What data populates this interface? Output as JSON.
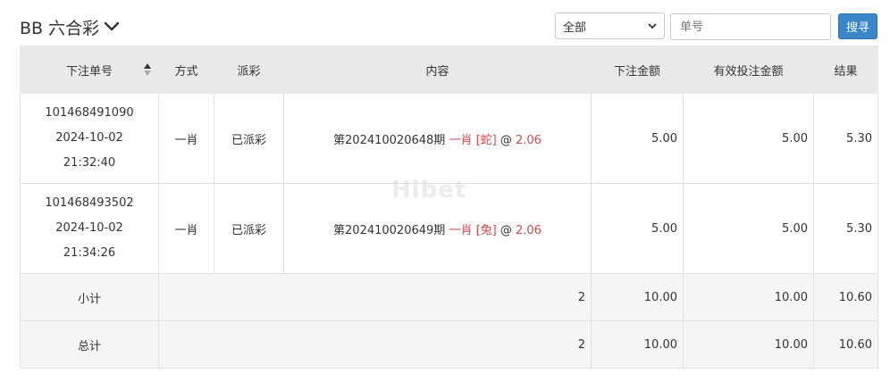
{
  "header": {
    "title": "BB 六合彩"
  },
  "filters": {
    "type_selected": "全部",
    "order_placeholder": "单号",
    "search_label": "搜寻"
  },
  "table": {
    "columns": [
      "下注单号",
      "方式",
      "派彩",
      "内容",
      "下注金额",
      "有效投注金额",
      "结果"
    ],
    "rows": [
      {
        "order_no": "101468491090",
        "date": "2024-10-02",
        "time": "21:32:40",
        "method": "一肖",
        "payout": "已派彩",
        "content_prefix": "第202410020648期",
        "content_bet": "一肖 [蛇]",
        "content_at": "@",
        "content_odds": "2.06",
        "bet_amount": "5.00",
        "valid_amount": "5.00",
        "result": "5.30"
      },
      {
        "order_no": "101468493502",
        "date": "2024-10-02",
        "time": "21:34:26",
        "method": "一肖",
        "payout": "已派彩",
        "content_prefix": "第202410020649期",
        "content_bet": "一肖 [兔]",
        "content_at": "@",
        "content_odds": "2.06",
        "bet_amount": "5.00",
        "valid_amount": "5.00",
        "result": "5.30"
      }
    ],
    "subtotal": {
      "label": "小计",
      "count": "2",
      "bet_amount": "10.00",
      "valid_amount": "10.00",
      "result": "10.60"
    },
    "total": {
      "label": "总计",
      "count": "2",
      "bet_amount": "10.00",
      "valid_amount": "10.00",
      "result": "10.60"
    }
  },
  "colors": {
    "accent": "#3a86c8",
    "highlight": "#d04a4a",
    "header_bg": "#e9e9e9",
    "footer_bg": "#f5f5f5"
  },
  "icons": {
    "title_chevron": "chevron-down-icon",
    "sort": "sort-icon",
    "select_arrow": "caret-down-icon"
  }
}
